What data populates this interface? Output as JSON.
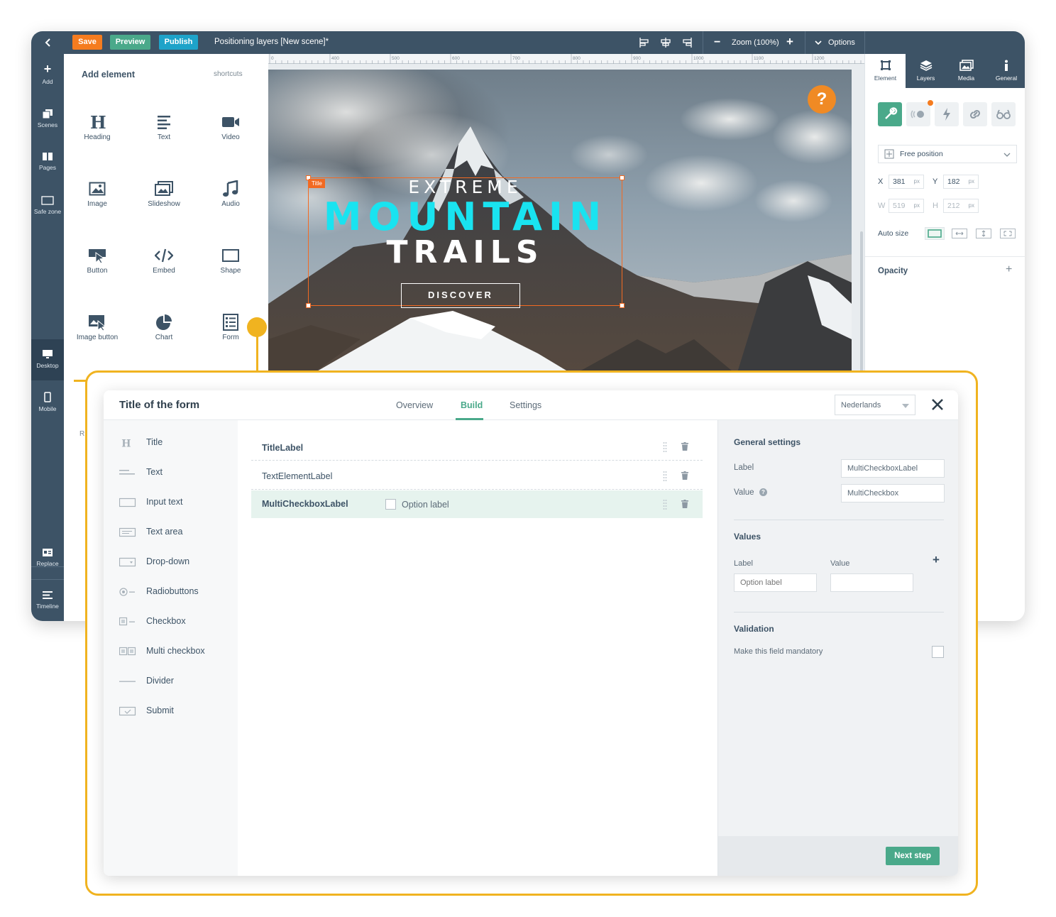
{
  "topbar": {
    "back_icon": "chevron-left-icon",
    "save": "Save",
    "preview": "Preview",
    "publish": "Publish",
    "title": "Positioning layers [New scene]*",
    "zoom": "Zoom (100%)",
    "options": "Options",
    "colors": {
      "bar": "#3d5366",
      "save": "#f57c1f",
      "preview": "#4aa98a",
      "publish": "#1ea3c9"
    }
  },
  "left_rail": {
    "add": "Add",
    "scenes": "Scenes",
    "pages": "Pages",
    "safe_zone": "Safe zone",
    "desktop": "Desktop",
    "mobile": "Mobile",
    "replace": "Replace",
    "timeline": "Timeline"
  },
  "add_panel": {
    "title": "Add element",
    "shortcuts": "shortcuts",
    "items": [
      {
        "label": "Heading",
        "icon": "heading-icon"
      },
      {
        "label": "Text",
        "icon": "text-icon"
      },
      {
        "label": "Video",
        "icon": "video-icon"
      },
      {
        "label": "Image",
        "icon": "image-icon"
      },
      {
        "label": "Slideshow",
        "icon": "slideshow-icon"
      },
      {
        "label": "Audio",
        "icon": "audio-icon"
      },
      {
        "label": "Button",
        "icon": "button-icon"
      },
      {
        "label": "Embed",
        "icon": "embed-icon"
      },
      {
        "label": "Shape",
        "icon": "shape-icon"
      },
      {
        "label": "Image button",
        "icon": "image-button-icon"
      },
      {
        "label": "Chart",
        "icon": "chart-icon"
      },
      {
        "label": "Form",
        "icon": "form-icon"
      }
    ],
    "cut_text": "R"
  },
  "canvas": {
    "ruler_ticks": [
      "0",
      "400",
      "500",
      "600",
      "700",
      "800",
      "900",
      "1000",
      "1100",
      "1200"
    ],
    "selection_tag": "Title",
    "headline_1": "EXTREME",
    "headline_2": "MOUNTAIN",
    "headline_3": "TRAILS",
    "cta": "DISCOVER",
    "help": "?"
  },
  "right_panel": {
    "tabs": [
      "Element",
      "Layers",
      "Media",
      "General"
    ],
    "position_mode": "Free position",
    "x_label": "X",
    "x_value": "381",
    "y_label": "Y",
    "y_value": "182",
    "w_label": "W",
    "w_value": "519",
    "h_label": "H",
    "h_value": "212",
    "unit": "px",
    "auto_size": "Auto size",
    "opacity": "Opacity",
    "opacity_add": "+",
    "accent": "#4aa98a"
  },
  "dialog": {
    "title": "Title of the form",
    "tabs": [
      "Overview",
      "Build",
      "Settings"
    ],
    "active_tab": "Build",
    "language": "Nederlands",
    "close_icon": "close-icon",
    "palette": [
      {
        "label": "Title",
        "icon": "heading-icon"
      },
      {
        "label": "Text",
        "icon": "text-lines-icon"
      },
      {
        "label": "Input text",
        "icon": "input-icon"
      },
      {
        "label": "Text area",
        "icon": "textarea-icon"
      },
      {
        "label": "Drop-down",
        "icon": "dropdown-icon"
      },
      {
        "label": "Radiobuttons",
        "icon": "radio-icon"
      },
      {
        "label": "Checkbox",
        "icon": "checkbox-icon"
      },
      {
        "label": "Multi checkbox",
        "icon": "multi-checkbox-icon"
      },
      {
        "label": "Divider",
        "icon": "divider-icon"
      },
      {
        "label": "Submit",
        "icon": "submit-icon"
      }
    ],
    "fields": [
      {
        "label": "TitleLabel",
        "option": ""
      },
      {
        "label": "TextElementLabel",
        "option": ""
      },
      {
        "label": "MultiCheckboxLabel",
        "option": "Option label"
      }
    ],
    "settings": {
      "general_heading": "General settings",
      "label": "Label",
      "label_value": "MultiCheckboxLabel",
      "value": "Value",
      "value_value": "MultiCheckbox",
      "values_heading": "Values",
      "col_label": "Label",
      "col_value": "Value",
      "add": "+",
      "option_placeholder": "Option label",
      "validation_heading": "Validation",
      "mandatory": "Make this field mandatory",
      "next": "Next step"
    },
    "frame_color": "#f0b320"
  }
}
